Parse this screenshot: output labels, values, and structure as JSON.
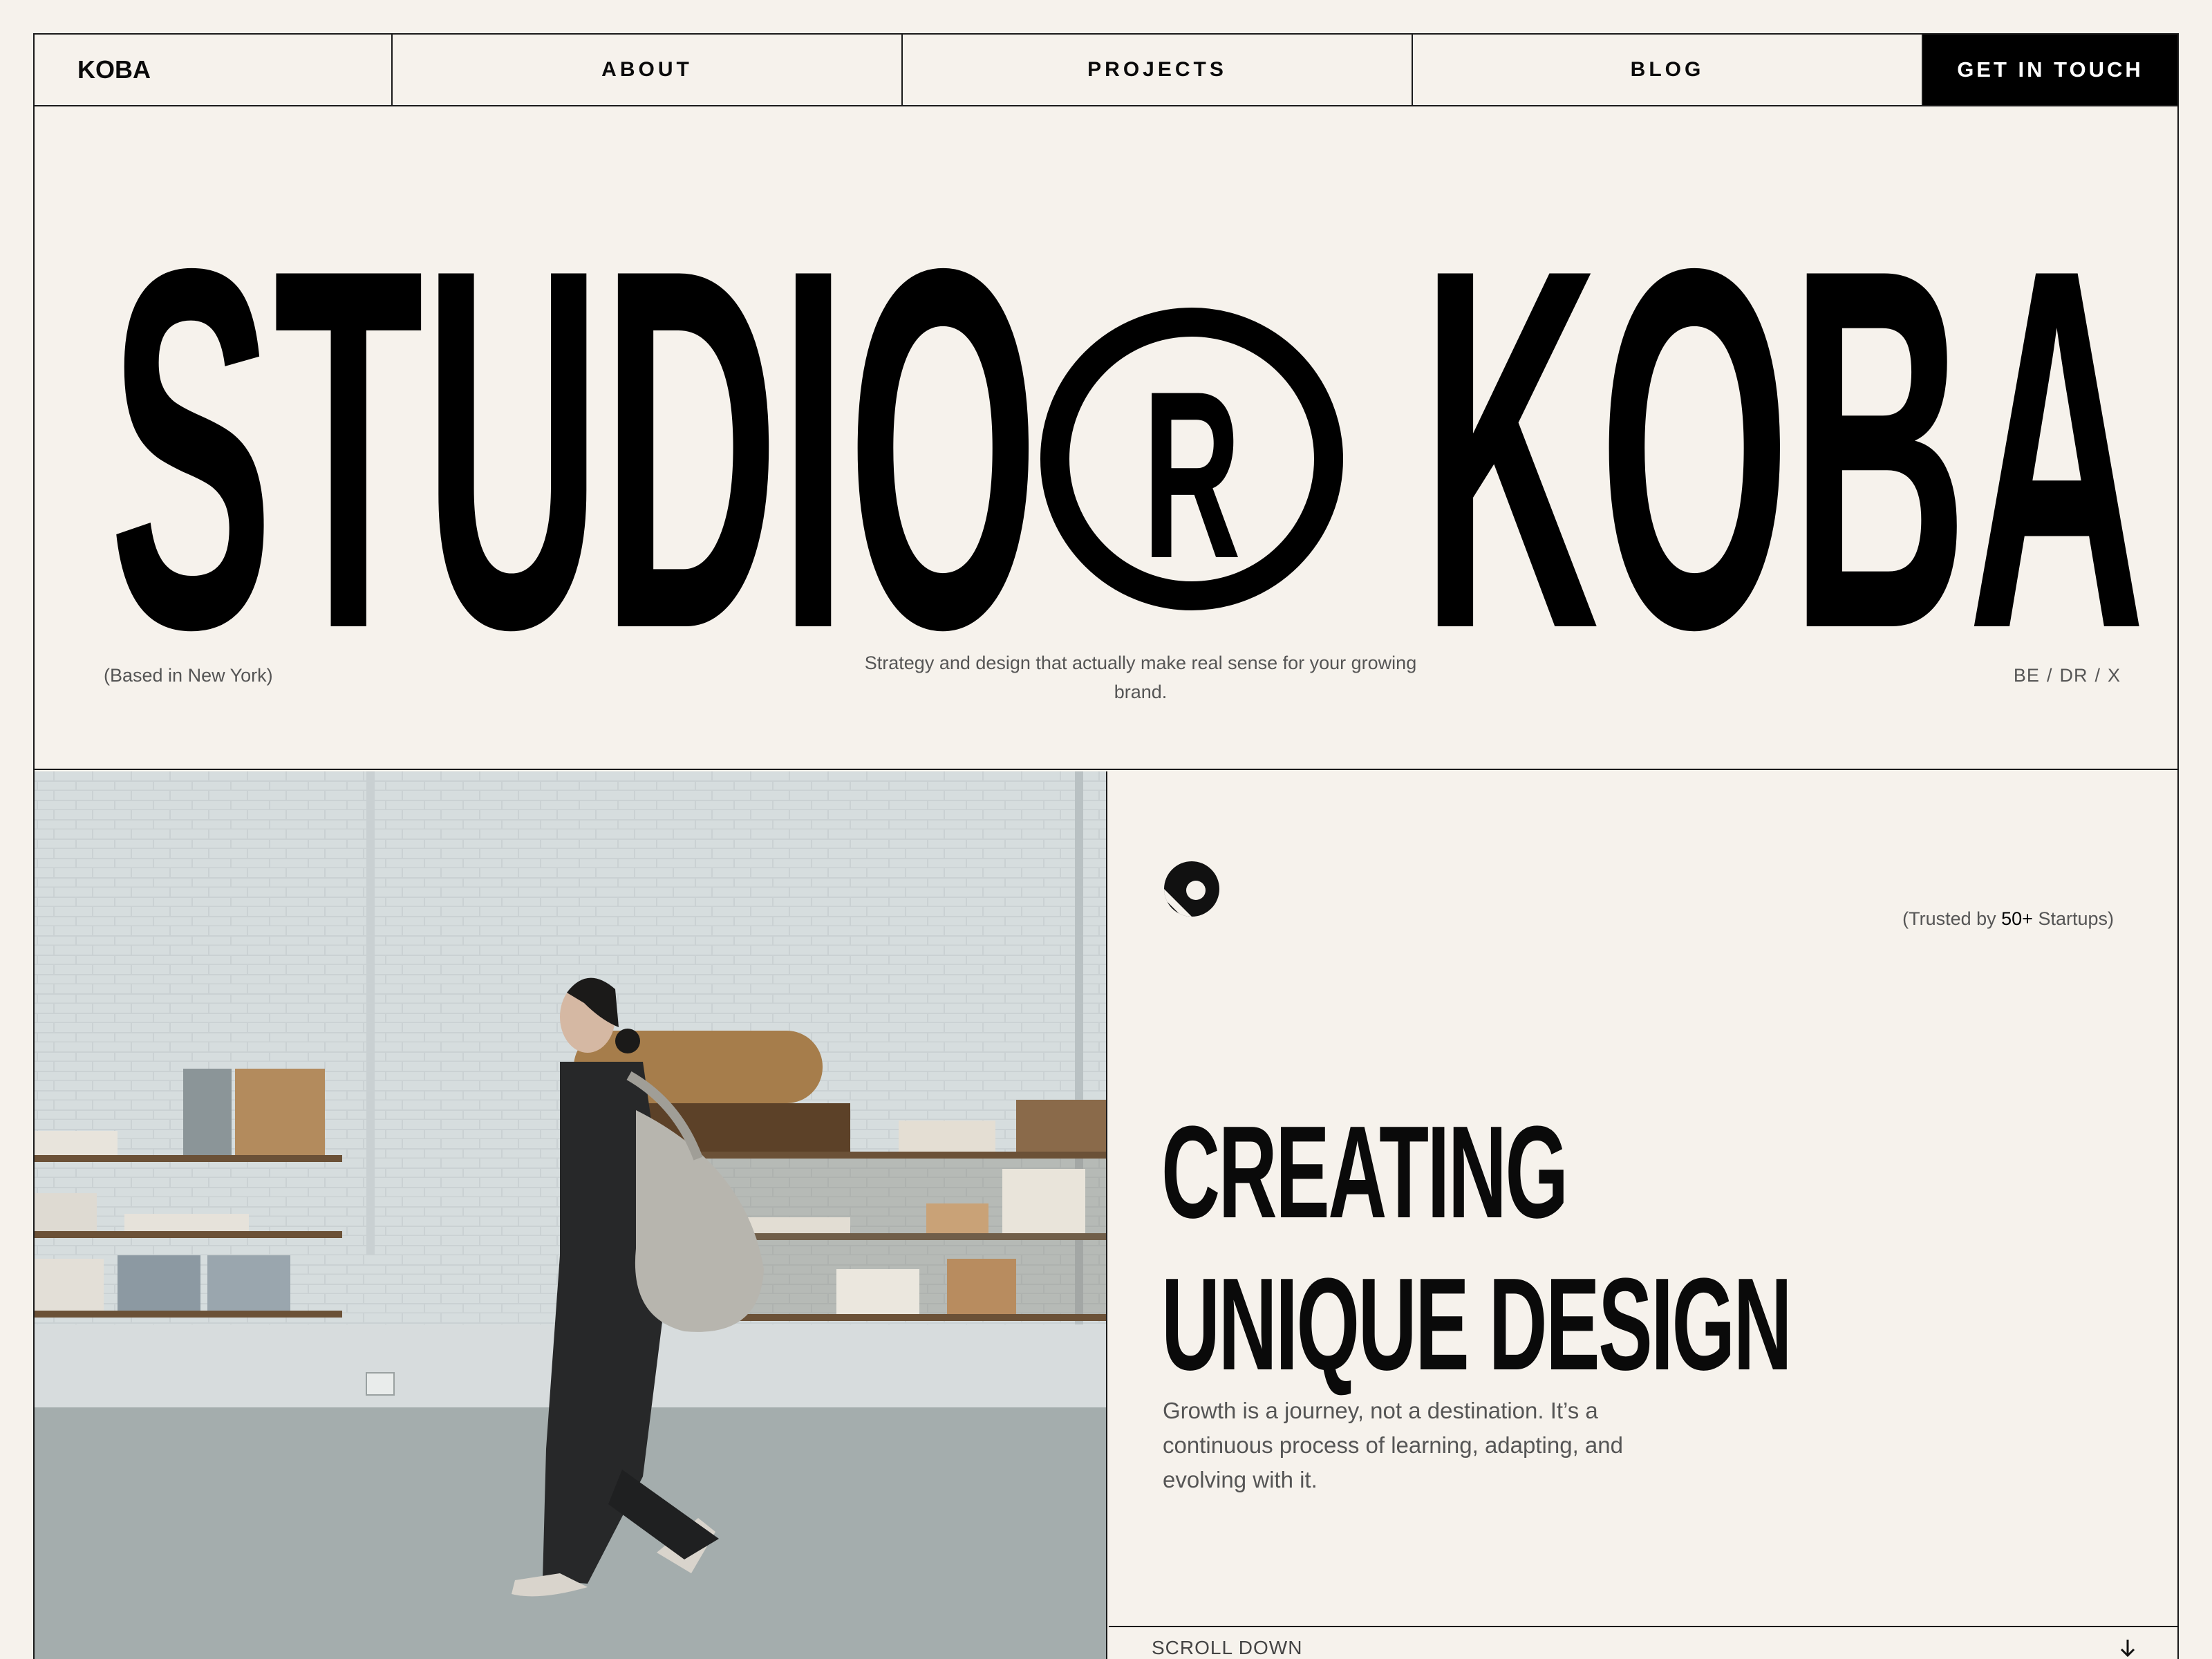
{
  "nav": {
    "logo": "KOBA",
    "about": "ABOUT",
    "projects": "PROJECTS",
    "blog": "BLOG",
    "cta": "GET IN TOUCH"
  },
  "hero": {
    "title_left": "STUDIO",
    "registered_mark": "R",
    "title_right": "KOBA",
    "location": "(Based in New York)",
    "tagline": "Strategy and design that actually make real sense for your growing brand.",
    "socials": [
      "BE",
      "DR",
      "X"
    ]
  },
  "panel": {
    "trusted_prefix": "(Trusted by ",
    "trusted_count": "50+",
    "trusted_suffix": " Startups)",
    "headline_line1": "CREATING",
    "headline_line2": "UNIQUE DESIGN",
    "description": "Growth is a journey, not a destination. It’s a continuous process of learning, adapting, and evolving with it.",
    "scroll_label": "SCROLL DOWN"
  },
  "icons": {
    "brand": "brand-mark-icon",
    "scroll": "arrow-down-icon"
  },
  "colors": {
    "background": "#f6f2ec",
    "ink": "#0a0a0a",
    "muted": "#555555",
    "cta_bg": "#000000"
  }
}
